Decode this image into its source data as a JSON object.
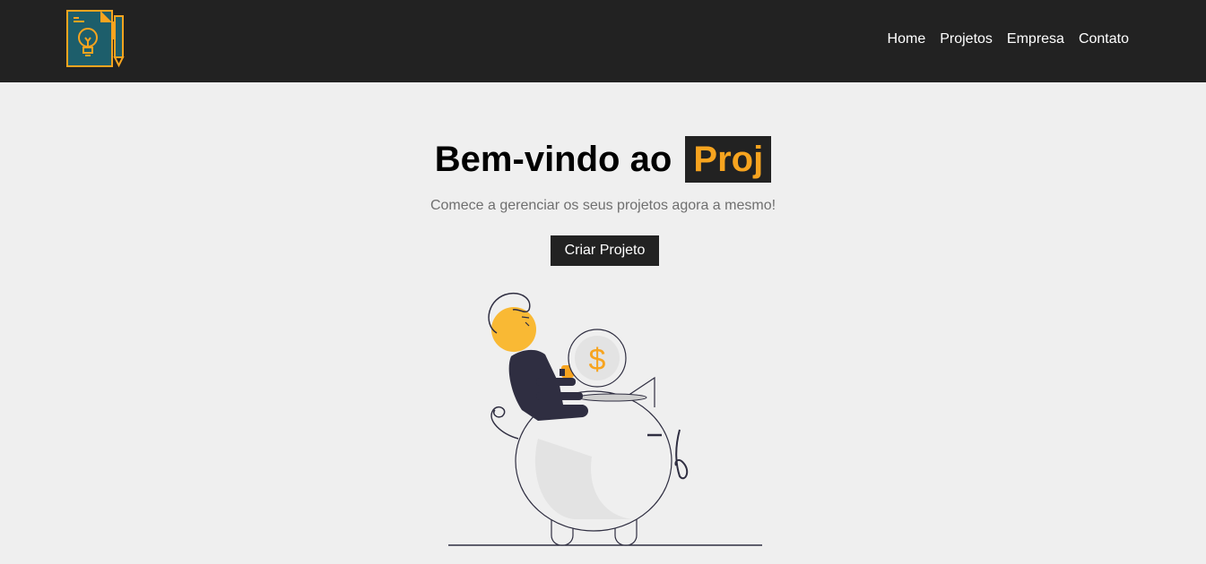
{
  "header": {
    "logo_icon": "lightbulb-document-pencil-logo",
    "nav": [
      {
        "label": "Home"
      },
      {
        "label": "Projetos"
      },
      {
        "label": "Empresa"
      },
      {
        "label": "Contato"
      }
    ]
  },
  "hero": {
    "title_prefix": "Bem-vindo ao",
    "title_brand": "Proj",
    "subtitle": "Comece a gerenciar os seus projetos agora a mesmo!",
    "cta_label": "Criar Projeto",
    "illustration_icon": "person-piggy-bank-illustration",
    "coin_symbol": "$"
  },
  "colors": {
    "navbar_bg": "#222222",
    "accent": "#f7a41f",
    "background": "#efefef",
    "logo_teal": "#1d5e6b",
    "illustration_dark": "#2f2e41"
  }
}
